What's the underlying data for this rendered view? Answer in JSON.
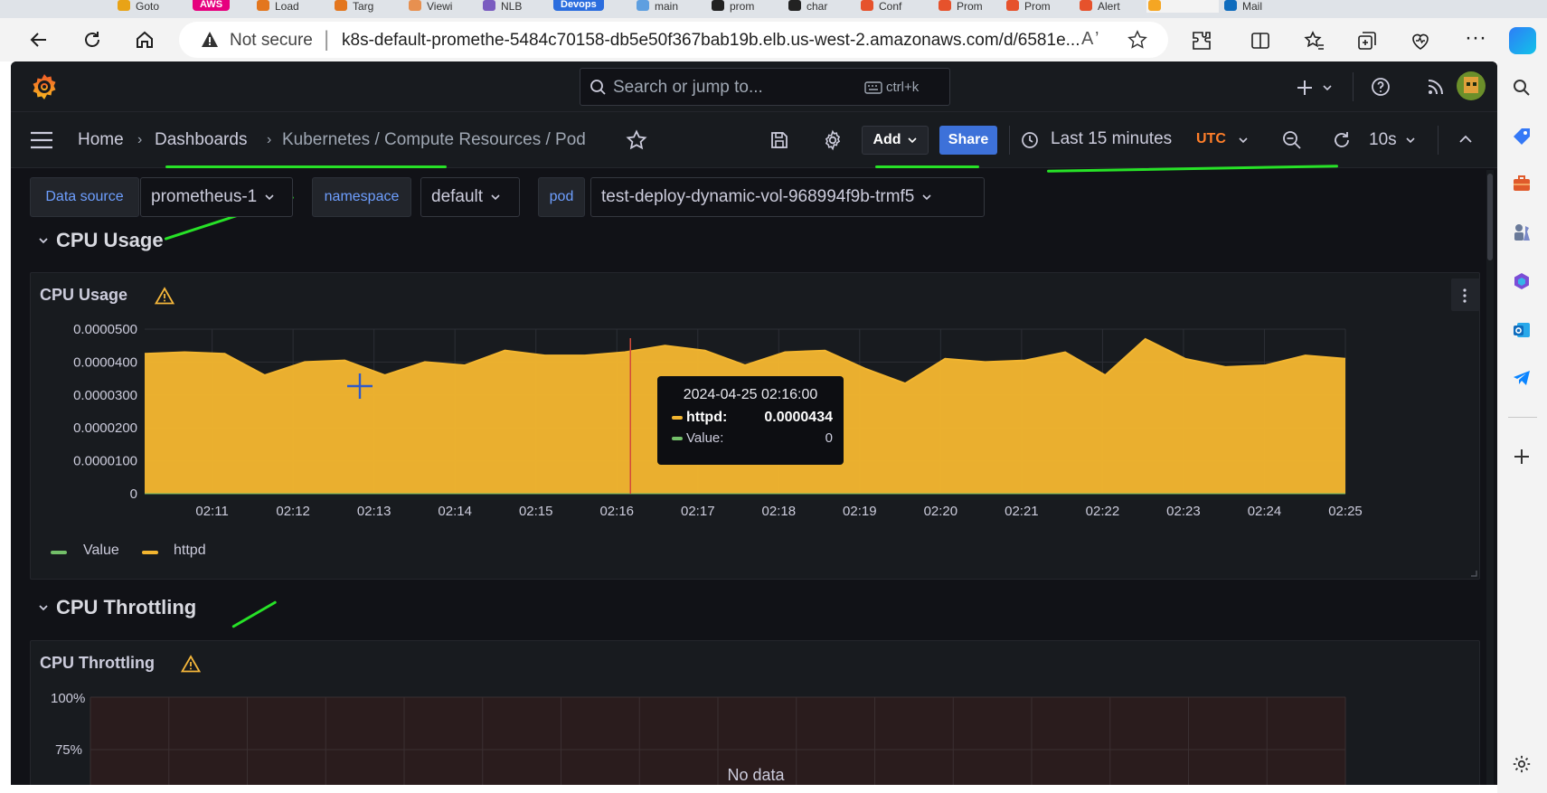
{
  "browser": {
    "tabs": [
      {
        "label": "Goto",
        "color": "#e8a317"
      },
      {
        "label": "AWS",
        "color": "#e6007e",
        "pill": true
      },
      {
        "label": "Load",
        "color": "#e3761e"
      },
      {
        "label": "Targ",
        "color": "#e3761e"
      },
      {
        "label": "Viewi",
        "color": "#e79050"
      },
      {
        "label": "NLB",
        "color": "#7a5cc0"
      },
      {
        "label": "Devops",
        "color": "#2b6dde",
        "pill": true
      },
      {
        "label": "main",
        "color": "#5e9fe0"
      },
      {
        "label": "prom",
        "color": "#222222"
      },
      {
        "label": "char",
        "color": "#222222"
      },
      {
        "label": "Conf",
        "color": "#e6522c"
      },
      {
        "label": "Prom",
        "color": "#e6522c"
      },
      {
        "label": "Prom",
        "color": "#e6522c"
      },
      {
        "label": "Alert",
        "color": "#e6522c"
      },
      {
        "label": "",
        "color": "#f5a623",
        "active": true
      },
      {
        "label": "Mail",
        "color": "#0f6cbd"
      }
    ],
    "security_label": "Not secure",
    "url": "k8s-default-promethe-5484c70158-db5e50f367bab19b.elb.us-west-2.amazonaws.com/d/6581e..."
  },
  "grafana": {
    "search_placeholder": "Search or jump to...",
    "search_shortcut": "ctrl+k",
    "breadcrumbs": [
      "Home",
      "Dashboards",
      "Kubernetes / Compute Resources / Pod"
    ],
    "add_label": "Add",
    "share_label": "Share",
    "time_range": "Last 15 minutes",
    "timezone": "UTC",
    "refresh_interval": "10s",
    "variables": [
      {
        "label": "Data source",
        "value": "prometheus-1"
      },
      {
        "label": "namespace",
        "value": "default"
      },
      {
        "label": "pod",
        "value": "test-deploy-dynamic-vol-968994f9b-trmf5"
      }
    ],
    "rows": [
      {
        "title": "CPU Usage"
      },
      {
        "title": "CPU Throttling"
      }
    ],
    "cpu_usage_panel": {
      "title": "CPU Usage",
      "tooltip": {
        "time": "2024-04-25 02:16:00",
        "items": [
          {
            "name": "httpd:",
            "value": "0.0000434",
            "color": "#f2b530"
          },
          {
            "name": "Value:",
            "value": "0",
            "color": "#73bf69"
          }
        ]
      },
      "legend": [
        {
          "name": "Value",
          "color": "#73bf69"
        },
        {
          "name": "httpd",
          "color": "#f2b530"
        }
      ]
    },
    "cpu_throttling_panel": {
      "title": "CPU Throttling",
      "no_data": "No data",
      "y_ticks": [
        "100%",
        "75%"
      ]
    }
  },
  "chart_data": {
    "type": "area",
    "title": "CPU Usage",
    "yticks": [
      "0.0000500",
      "0.0000400",
      "0.0000300",
      "0.0000200",
      "0.0000100",
      "0"
    ],
    "ylim": [
      0,
      5e-05
    ],
    "xticks": [
      "02:11",
      "02:12",
      "02:13",
      "02:14",
      "02:15",
      "02:16",
      "02:17",
      "02:18",
      "02:19",
      "02:20",
      "02:21",
      "02:22",
      "02:23",
      "02:24",
      "02:25"
    ],
    "x_start": "02:10:10",
    "x_end": "02:25:00",
    "series": [
      {
        "name": "httpd",
        "color": "#f2b530",
        "values": [
          4.25e-05,
          4.3e-05,
          4.25e-05,
          3.6e-05,
          4e-05,
          4.05e-05,
          3.6e-05,
          4e-05,
          3.9e-05,
          4.35e-05,
          4.2e-05,
          4.2e-05,
          4.3e-05,
          4.5e-05,
          4.35e-05,
          3.9e-05,
          4.3e-05,
          4.35e-05,
          3.8e-05,
          3.35e-05,
          4.1e-05,
          4e-05,
          4.05e-05,
          4.3e-05,
          3.6e-05,
          4.7e-05,
          4.1e-05,
          3.85e-05,
          3.9e-05,
          4.2e-05,
          4.1e-05
        ]
      },
      {
        "name": "Value",
        "color": "#73bf69",
        "values": [
          0,
          0,
          0,
          0,
          0,
          0,
          0,
          0,
          0,
          0,
          0,
          0,
          0,
          0,
          0,
          0,
          0,
          0,
          0,
          0,
          0,
          0,
          0,
          0,
          0,
          0,
          0,
          0,
          0,
          0,
          0
        ]
      }
    ],
    "grid": true,
    "legend_position": "bottom-left"
  }
}
